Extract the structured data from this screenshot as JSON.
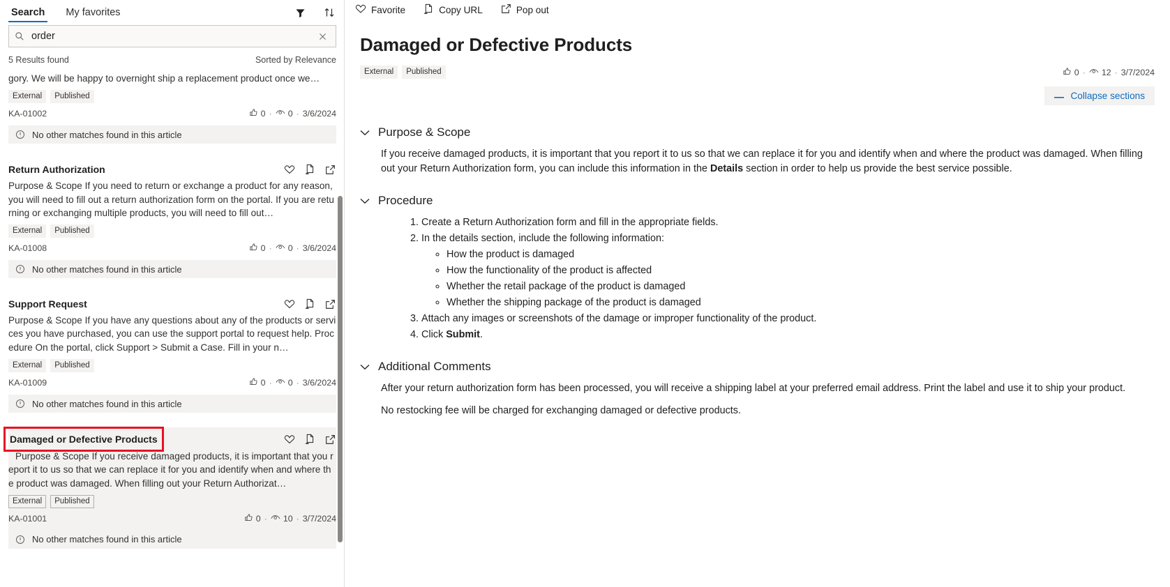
{
  "left": {
    "tabs": [
      {
        "label": "Search",
        "active": true
      },
      {
        "label": "My favorites",
        "active": false
      }
    ],
    "toolbar": {
      "filter_icon": "filter-icon",
      "sort_icon": "sort-icon"
    },
    "search": {
      "value": "order",
      "placeholder": "Search",
      "search_icon": "search-icon",
      "clear_icon": "close-icon"
    },
    "results_count_label": "5 Results found",
    "sorted_label": "Sorted by Relevance",
    "no_match_label": "No other matches found in this article",
    "results": [
      {
        "title": "",
        "snippet": "gory. We will be happy to overnight ship a replacement product once we…",
        "badges": [
          "External",
          "Published"
        ],
        "ka_id": "KA-01002",
        "likes": "0",
        "views": "0",
        "date": "3/6/2024",
        "selected": false,
        "partial": true
      },
      {
        "title": "Return Authorization",
        "snippet": "Purpose & Scope If you need to return or exchange a product for any reason, you will need to fill out a return authorization form on the portal. If you are returning or exchanging multiple products, you will need to fill out…",
        "badges": [
          "External",
          "Published"
        ],
        "ka_id": "KA-01008",
        "likes": "0",
        "views": "0",
        "date": "3/6/2024",
        "selected": false,
        "partial": false
      },
      {
        "title": "Support Request",
        "snippet": "Purpose & Scope If you have any questions about any of the products or services you have purchased, you can use the support portal to request help. Procedure On the portal, click Support > Submit a Case. Fill in your n…",
        "badges": [
          "External",
          "Published"
        ],
        "ka_id": "KA-01009",
        "likes": "0",
        "views": "0",
        "date": "3/6/2024",
        "selected": false,
        "partial": false
      },
      {
        "title": "Damaged or Defective Products",
        "snippet": "Purpose & Scope If you receive damaged products, it is important that you report it to us so that we can replace it for you and identify when and where the product was damaged. When filling out your Return Authorizat…",
        "badges": [
          "External",
          "Published"
        ],
        "ka_id": "KA-01001",
        "likes": "0",
        "views": "10",
        "date": "3/7/2024",
        "selected": true,
        "partial": false
      }
    ],
    "result_action_icons": [
      "heart-icon",
      "copy-url-icon",
      "pop-out-icon"
    ]
  },
  "right": {
    "commands": [
      {
        "label": "Favorite",
        "icon": "heart-icon"
      },
      {
        "label": "Copy URL",
        "icon": "copy-url-icon"
      },
      {
        "label": "Pop out",
        "icon": "pop-out-icon"
      }
    ],
    "article": {
      "title": "Damaged or Defective Products",
      "badges": [
        "External",
        "Published"
      ],
      "likes": "0",
      "views": "12",
      "date": "3/7/2024",
      "collapse_label": "Collapse sections",
      "sections": [
        {
          "title": "Purpose & Scope",
          "type": "paragraphs",
          "paragraphs": [
            {
              "runs": [
                {
                  "text": "If you receive damaged products, it is important that you report it to us so that we can replace it for you and identify when and where the product was damaged. When filling out your Return Authorization form, you can include this information in the ",
                  "bold": false
                },
                {
                  "text": "Details",
                  "bold": true
                },
                {
                  "text": " section in order to help us provide the best service possible.",
                  "bold": false
                }
              ]
            }
          ]
        },
        {
          "title": "Procedure",
          "type": "list",
          "items": [
            {
              "runs": [
                {
                  "text": "Create a Return Authorization form and fill in the appropriate fields.",
                  "bold": false
                }
              ],
              "sub": []
            },
            {
              "runs": [
                {
                  "text": "In the details section, include the following information:",
                  "bold": false
                }
              ],
              "sub": [
                "How the product is damaged",
                "How the functionality of the product is affected",
                "Whether the retail package of the product is damaged",
                "Whether the shipping package of the product is damaged"
              ]
            },
            {
              "runs": [
                {
                  "text": "Attach any images or screenshots of the damage or improper functionality of the product.",
                  "bold": false
                }
              ],
              "sub": []
            },
            {
              "runs": [
                {
                  "text": "Click ",
                  "bold": false
                },
                {
                  "text": "Submit",
                  "bold": true
                },
                {
                  "text": ".",
                  "bold": false
                }
              ],
              "sub": []
            }
          ]
        },
        {
          "title": "Additional Comments",
          "type": "paragraphs",
          "paragraphs": [
            {
              "runs": [
                {
                  "text": "After your return authorization form has been processed, you will receive a shipping label at your preferred email address. Print the label and use it to ship your product.",
                  "bold": false
                }
              ]
            },
            {
              "runs": [
                {
                  "text": "No restocking fee will be charged for exchanging damaged or defective products.",
                  "bold": false
                }
              ]
            }
          ]
        }
      ]
    }
  },
  "colors": {
    "accent": "#0f6cbd",
    "highlight_box": "#e81123",
    "badge_bg": "#f3f2f1",
    "text": "#201f1e"
  }
}
